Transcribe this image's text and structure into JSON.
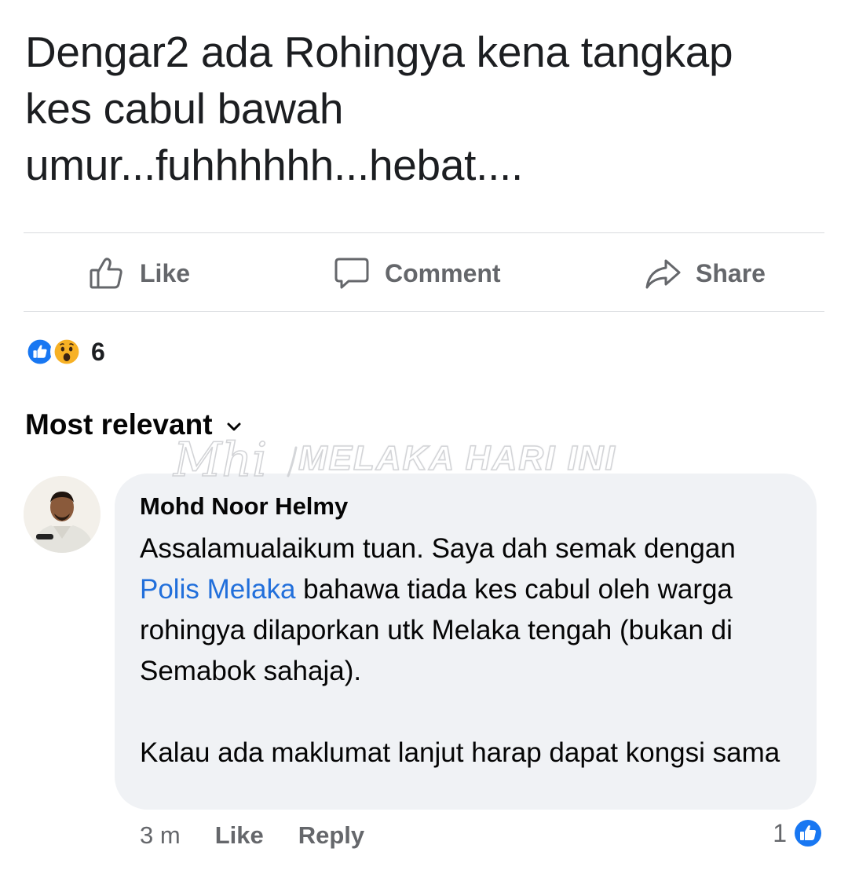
{
  "post": {
    "text_line1": "Dengar2 ada Rohingya kena tangkap",
    "text_line2": "kes cabul bawah",
    "text_line3": "umur...fuhhhhhh...hebat...."
  },
  "actions": {
    "like": "Like",
    "comment": "Comment",
    "share": "Share"
  },
  "reactions": {
    "count": "6",
    "icons": [
      "like-reaction-icon",
      "wow-reaction-icon"
    ]
  },
  "sort": {
    "label": "Most relevant"
  },
  "watermark": {
    "text": "MELAKA HARI INI",
    "logo": "Mhi"
  },
  "comment": {
    "author": "Mohd Noor Helmy",
    "p1_before": "Assalamualaikum tuan. Saya dah semak dengan ",
    "p1_mention": "Polis Melaka",
    "p1_after": " bahawa tiada kes cabul oleh warga rohingya dilaporkan utk Melaka tengah (bukan di Semabok sahaja).",
    "p2": "Kalau ada maklumat lanjut harap dapat kongsi sama",
    "time": "3 m",
    "like_label": "Like",
    "reply_label": "Reply",
    "like_count": "1"
  },
  "colors": {
    "fb_blue": "#1877f2",
    "mention": "#216fdb",
    "bubble_bg": "#f0f2f5",
    "secondary_text": "#65676b"
  }
}
